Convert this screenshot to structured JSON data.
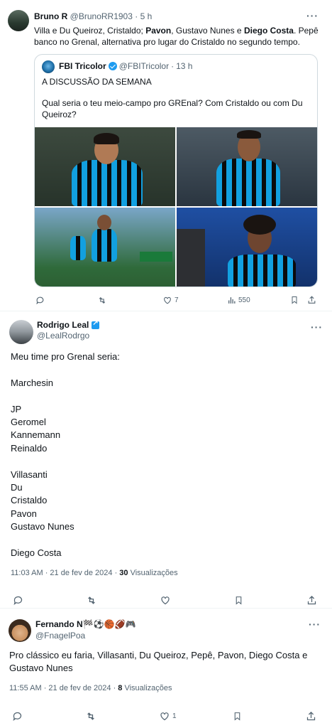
{
  "post1": {
    "author_name": "Bruno R",
    "author_handle": "@BrunoRR1903",
    "time": "5 h",
    "text_parts": [
      "Villa e Du Queiroz, Cristaldo; ",
      "Pavon",
      ", Gustavo Nunes e ",
      "Diego Costa",
      ". Pepê banco no Grenal, alternativa pro lugar do Cristaldo no segundo tempo."
    ],
    "quote": {
      "author_name": "FBI Tricolor",
      "author_handle": "@FBITricolor",
      "time": "13 h",
      "title": "A DISCUSSÃO DA SEMANA",
      "body": "Qual seria o teu meio-campo pro GREnal? Com Cristaldo ou com Du Queiroz?"
    },
    "actions": {
      "replies": "",
      "reposts": "",
      "likes": "7",
      "views": "550"
    }
  },
  "post2": {
    "author_name": "Rodrigo Leal",
    "author_handle": "@LealRodrgo",
    "lines": [
      "Meu time pro Grenal seria:",
      "",
      "Marchesin",
      "",
      "JP",
      "Geromel",
      "Kannemann",
      "Reinaldo",
      "",
      "Villasanti",
      "Du",
      "Cristaldo",
      "Pavon",
      "Gustavo Nunes",
      "",
      "Diego Costa"
    ],
    "timestamp": "11:03 AM · 21 de fev de 2024 · ",
    "views_count": "30",
    "views_label": " Visualizações"
  },
  "post3": {
    "author_name": "Fernando N",
    "name_emojis": "🏁⚽🏀🏈🎮",
    "author_handle": "@FnagelPoa",
    "text": "Pro clássico eu faria,  Villasanti,  Du Queiroz,  Pepê,  Pavon,  Diego Costa e Gustavo Nunes",
    "timestamp": "11:55 AM · 21 de fev de 2024 · ",
    "views_count": "8",
    "views_label": " Visualizações",
    "actions": {
      "likes": "1"
    }
  },
  "ui": {
    "more": "···",
    "dot": " · "
  },
  "colors": {
    "accent": "#1d9bf0",
    "muted": "#536471",
    "text": "#0f1419",
    "border": "#cfd9de"
  }
}
